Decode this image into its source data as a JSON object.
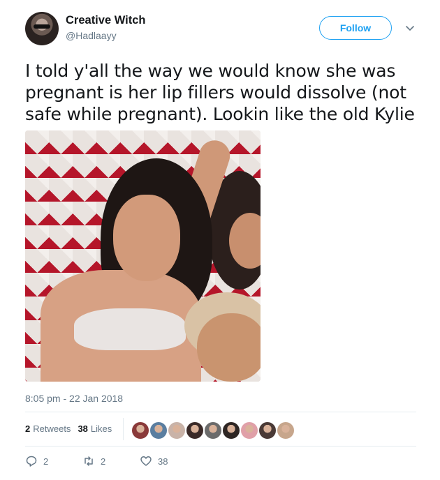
{
  "user": {
    "name": "Creative Witch",
    "handle": "@Hadlaayy"
  },
  "follow_label": "Follow",
  "tweet_text": "I told y'all the way we would know she was pregnant is her lip fillers would dissolve (not safe while pregnant). Lookin like the old Kylie",
  "timestamp": "8:05 pm - 22 Jan 2018",
  "stats": {
    "retweets_count": "2",
    "retweets_label": "Retweets",
    "likes_count": "38",
    "likes_label": "Likes"
  },
  "liker_colors": [
    "#8a3a3a",
    "#5a7ea0",
    "#c9b3a8",
    "#3a2a28",
    "#6b6b6b",
    "#2e2624",
    "#e0a0a8",
    "#4a3a36",
    "#c7a68c"
  ],
  "actions": {
    "reply_count": "2",
    "retweet_count": "2",
    "like_count": "38"
  },
  "colors": {
    "accent": "#1da1f2",
    "secondary_text": "#657786"
  }
}
